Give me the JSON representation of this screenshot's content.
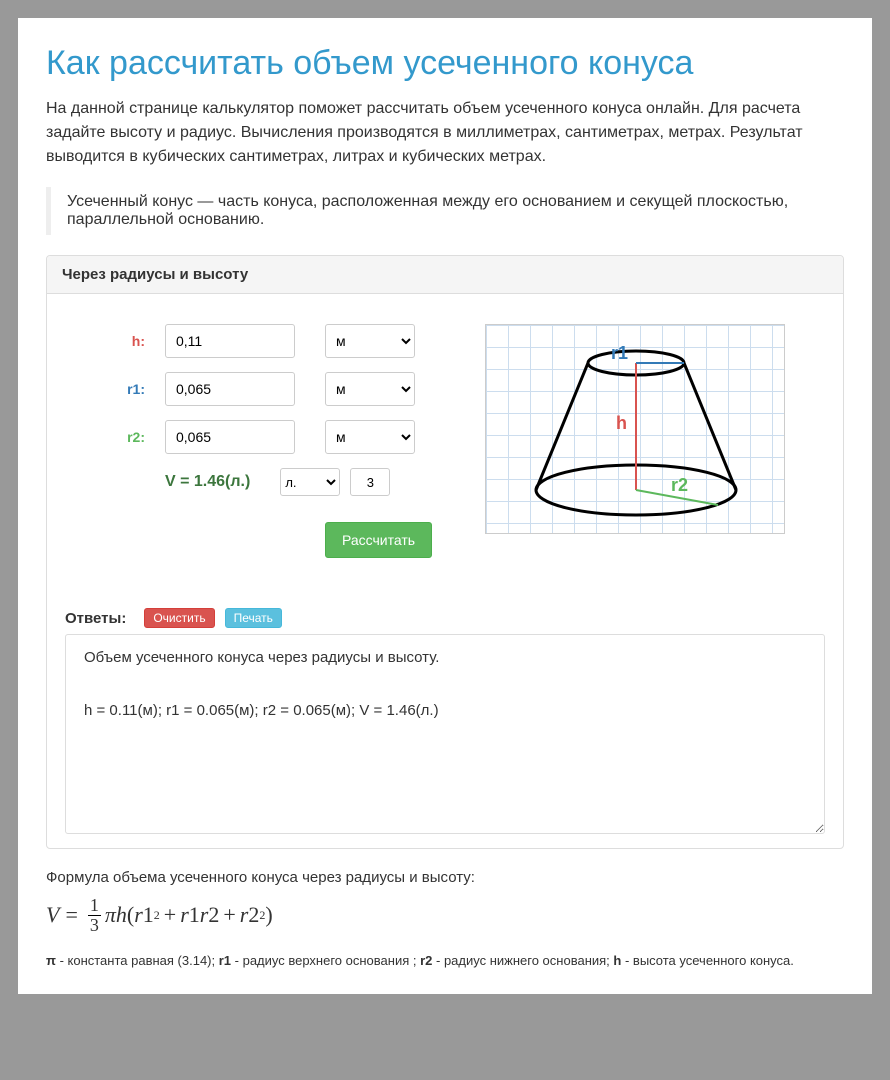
{
  "title": "Как рассчитать объем усеченного конуса",
  "intro": "На данной странице калькулятор поможет рассчитать объем усеченного конуса онлайн. Для расчета задайте высоту и радиус. Вычисления производятся в миллиметрах, сантиметрах, метрах. Результат выводится в кубических сантиметрах, литрах и кубических метрах.",
  "definition": "Усеченный конус — часть конуса, расположенная между его основанием и секущей плоскостью, параллельной основанию.",
  "panel": {
    "header": "Через радиусы и высоту",
    "labels": {
      "h": "h:",
      "r1": "r1:",
      "r2": "r2:"
    },
    "values": {
      "h": "0,11",
      "r1": "0,065",
      "r2": "0,065"
    },
    "unit_option": "м",
    "result_label": "V = 1.46(л.)",
    "result_unit": "л.",
    "round": "3",
    "calc_button": "Рассчитать",
    "figure_labels": {
      "r1": "r1",
      "h": "h",
      "r2": "r2"
    }
  },
  "answers": {
    "title": "Ответы:",
    "clear": "Очистить",
    "print": "Печать",
    "line1": "Объем усеченного конуса через радиусы и высоту.",
    "line2": "h = 0.11(м); r1 = 0.065(м); r2 = 0.065(м); V = 1.46(л.)"
  },
  "post": {
    "heading": "Формула объема усеченного конуса через радиусы и высоту:",
    "legend_pi": "π",
    "legend_pi_text": " - константа равная (3.14); ",
    "legend_r1": "r1",
    "legend_r1_text": " - радиус верхнего основания ; ",
    "legend_r2": "r2",
    "legend_r2_text": " - радиус нижнего основания; ",
    "legend_h": "h",
    "legend_h_text": " - высота усеченного конуса."
  }
}
